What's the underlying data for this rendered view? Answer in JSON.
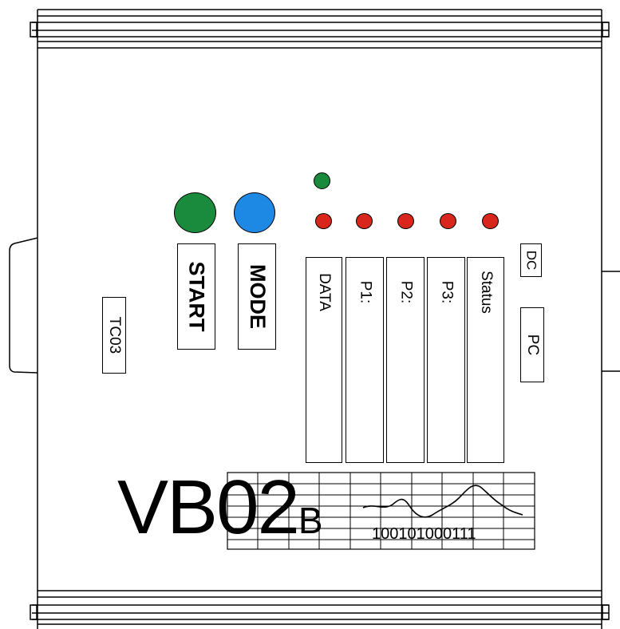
{
  "device": {
    "model_main": "VB02",
    "model_suffix": "B",
    "side_label": "TC03",
    "buttons": {
      "start_label": "START",
      "start_color": "#1a8a3c",
      "mode_label": "MODE",
      "mode_color": "#1e88e5"
    },
    "status_led_color": "#1a8a3c",
    "channel_led_color": "#d9261c",
    "slots": [
      "DATA",
      "P1:",
      "P2:",
      "P3:",
      "Status"
    ],
    "dc_label": "DC",
    "pc_label": "PC",
    "binary_readout": "100101000111"
  }
}
